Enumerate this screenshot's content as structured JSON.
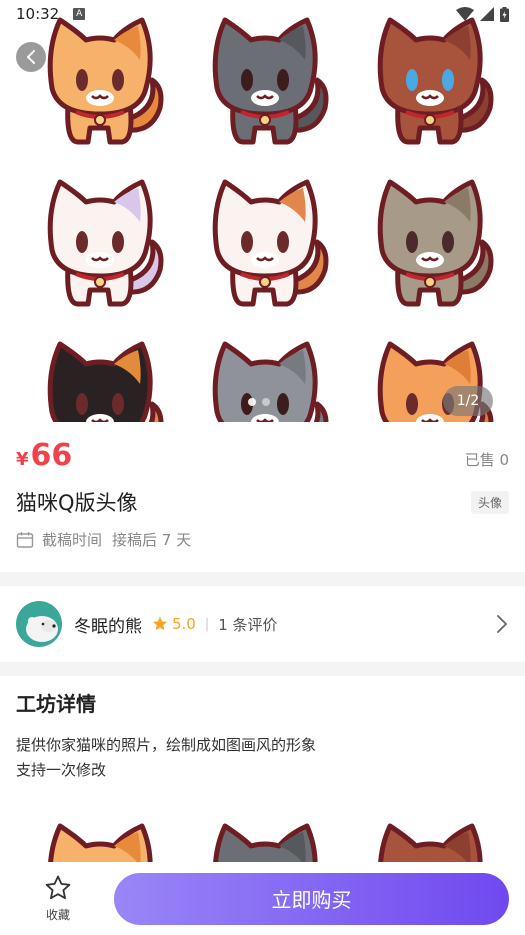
{
  "status_bar": {
    "time": "10:32",
    "notif_icon": "A"
  },
  "gallery": {
    "counter": "1/2",
    "cats": [
      {
        "name": "orange-cat",
        "body": "#f6b26b",
        "patch": "#e88a3c",
        "eye": "#6b2b2b"
      },
      {
        "name": "gray-cat",
        "body": "#6b6f75",
        "patch": "#55595e",
        "eye": "#3b1d1d"
      },
      {
        "name": "brown-cat",
        "body": "#a8533c",
        "patch": "#8e4030",
        "eye": "#4aa9e0"
      },
      {
        "name": "white-cat",
        "body": "#fbf3ef",
        "patch": "#d8c7e8",
        "eye": "#6b2b2b"
      },
      {
        "name": "calico-cat",
        "body": "#fbf3ef",
        "patch": "#e2874b",
        "eye": "#6b2b2b"
      },
      {
        "name": "tabby-cat",
        "body": "#a89a88",
        "patch": "#8a7a66",
        "eye": "#4a2a2a"
      },
      {
        "name": "black-cat",
        "body": "#2a2222",
        "patch": "#e38b3c",
        "eye": "#6b2b2b"
      },
      {
        "name": "silver-cat",
        "body": "#8f9399",
        "patch": "#777b80",
        "eye": "#3b1d1d"
      },
      {
        "name": "ginger-cat",
        "body": "#f4a05a",
        "patch": "#e07d36",
        "eye": "#6b2b2b"
      }
    ]
  },
  "product": {
    "currency": "¥",
    "price": "66",
    "sold": "已售 0",
    "title": "猫咪Q版头像",
    "tag": "头像",
    "deadline_label": "截稿时间",
    "deadline_value": "接稿后 7 天"
  },
  "seller": {
    "name": "冬眠的熊",
    "rating": "5.0",
    "reviews": "1 条评价"
  },
  "details": {
    "title": "工坊详情",
    "line1": "提供你家猫咪的照片，绘制成如图画风的形象",
    "line2": "支持一次修改"
  },
  "bottom": {
    "fav_label": "收藏",
    "buy_label": "立即购买"
  },
  "colors": {
    "price": "#f0424b",
    "star": "#f5a623",
    "button_start": "#9a86f7",
    "button_end": "#6f49ef"
  }
}
